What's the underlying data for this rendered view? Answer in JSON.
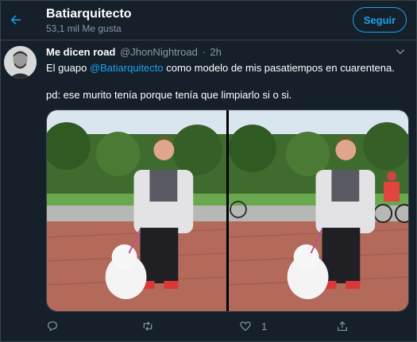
{
  "header": {
    "title": "Batiarquitecto",
    "subtitle": "53,1 mil Me gusta",
    "follow_label": "Seguir"
  },
  "tweet": {
    "author_name": "Me dicen road",
    "author_handle": "@JhonNightroad",
    "separator": "·",
    "time": "2h",
    "text_before": "El guapo ",
    "mention": "@Batiarquitecto",
    "text_after": " como modelo de mis pasatiempos en cuarentena.",
    "text_line2": "pd: ese murito tenía porque tenía que limpiarlo si o si.",
    "media": [
      "photo-1",
      "photo-2"
    ]
  },
  "actions": {
    "reply_count": "",
    "retweet_count": "",
    "like_count": "1",
    "share_count": ""
  },
  "colors": {
    "background": "#15202b",
    "accent": "#1da1f2",
    "secondary_text": "#8899a6",
    "border": "#38444d"
  },
  "icons": [
    "back-arrow-icon",
    "chevron-down-icon",
    "reply-icon",
    "retweet-icon",
    "like-icon",
    "share-icon"
  ]
}
